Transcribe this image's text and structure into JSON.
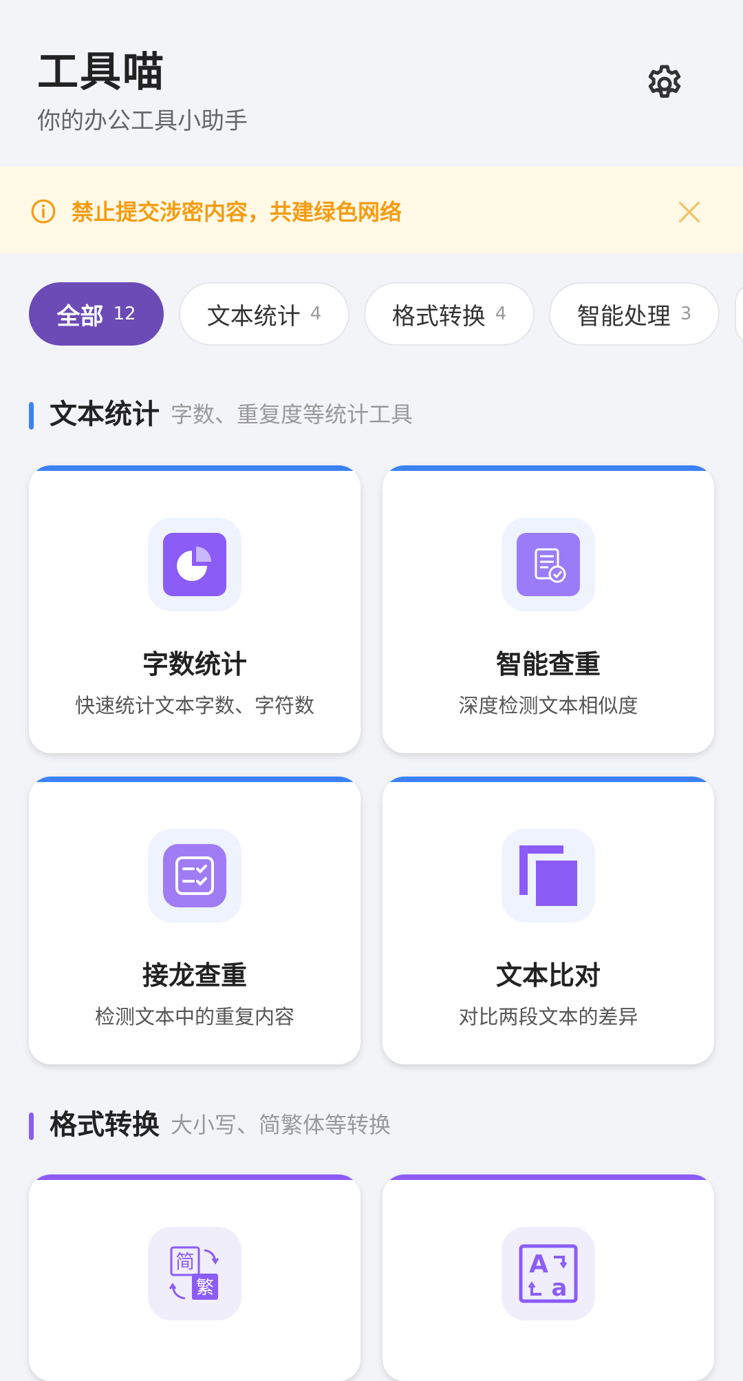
{
  "header": {
    "title": "工具喵",
    "subtitle": "你的办公工具小助手"
  },
  "notice": {
    "text": "禁止提交涉密内容，共建绿色网络"
  },
  "chips": [
    {
      "label": "全部",
      "count": "12"
    },
    {
      "label": "文本统计",
      "count": "4"
    },
    {
      "label": "格式转换",
      "count": "4"
    },
    {
      "label": "智能处理",
      "count": "3"
    }
  ],
  "sections": [
    {
      "title": "文本统计",
      "desc": "字数、重复度等统计工具",
      "color": "#3B82F6",
      "cards": [
        {
          "name": "字数统计",
          "desc": "快速统计文本字数、字符数",
          "icon": "pie-chart-icon"
        },
        {
          "name": "智能查重",
          "desc": "深度检测文本相似度",
          "icon": "document-check-icon"
        },
        {
          "name": "接龙查重",
          "desc": "检测文本中的重复内容",
          "icon": "checklist-icon"
        },
        {
          "name": "文本比对",
          "desc": "对比两段文本的差异",
          "icon": "copy-icon"
        }
      ]
    },
    {
      "title": "格式转换",
      "desc": "大小写、简繁体等转换",
      "color": "#8B5CF6",
      "cards": [
        {
          "name": "",
          "desc": "",
          "icon": "simplified-traditional-icon",
          "glyph_top": "简",
          "glyph_bottom": "繁"
        },
        {
          "name": "",
          "desc": "",
          "icon": "case-convert-icon",
          "glyph_top": "A",
          "glyph_bottom": "a"
        }
      ]
    }
  ],
  "colors": {
    "accent": "#6B4BB6",
    "notice": "#F39C12",
    "blue": "#3B82F6",
    "purple": "#8B5CF6"
  }
}
